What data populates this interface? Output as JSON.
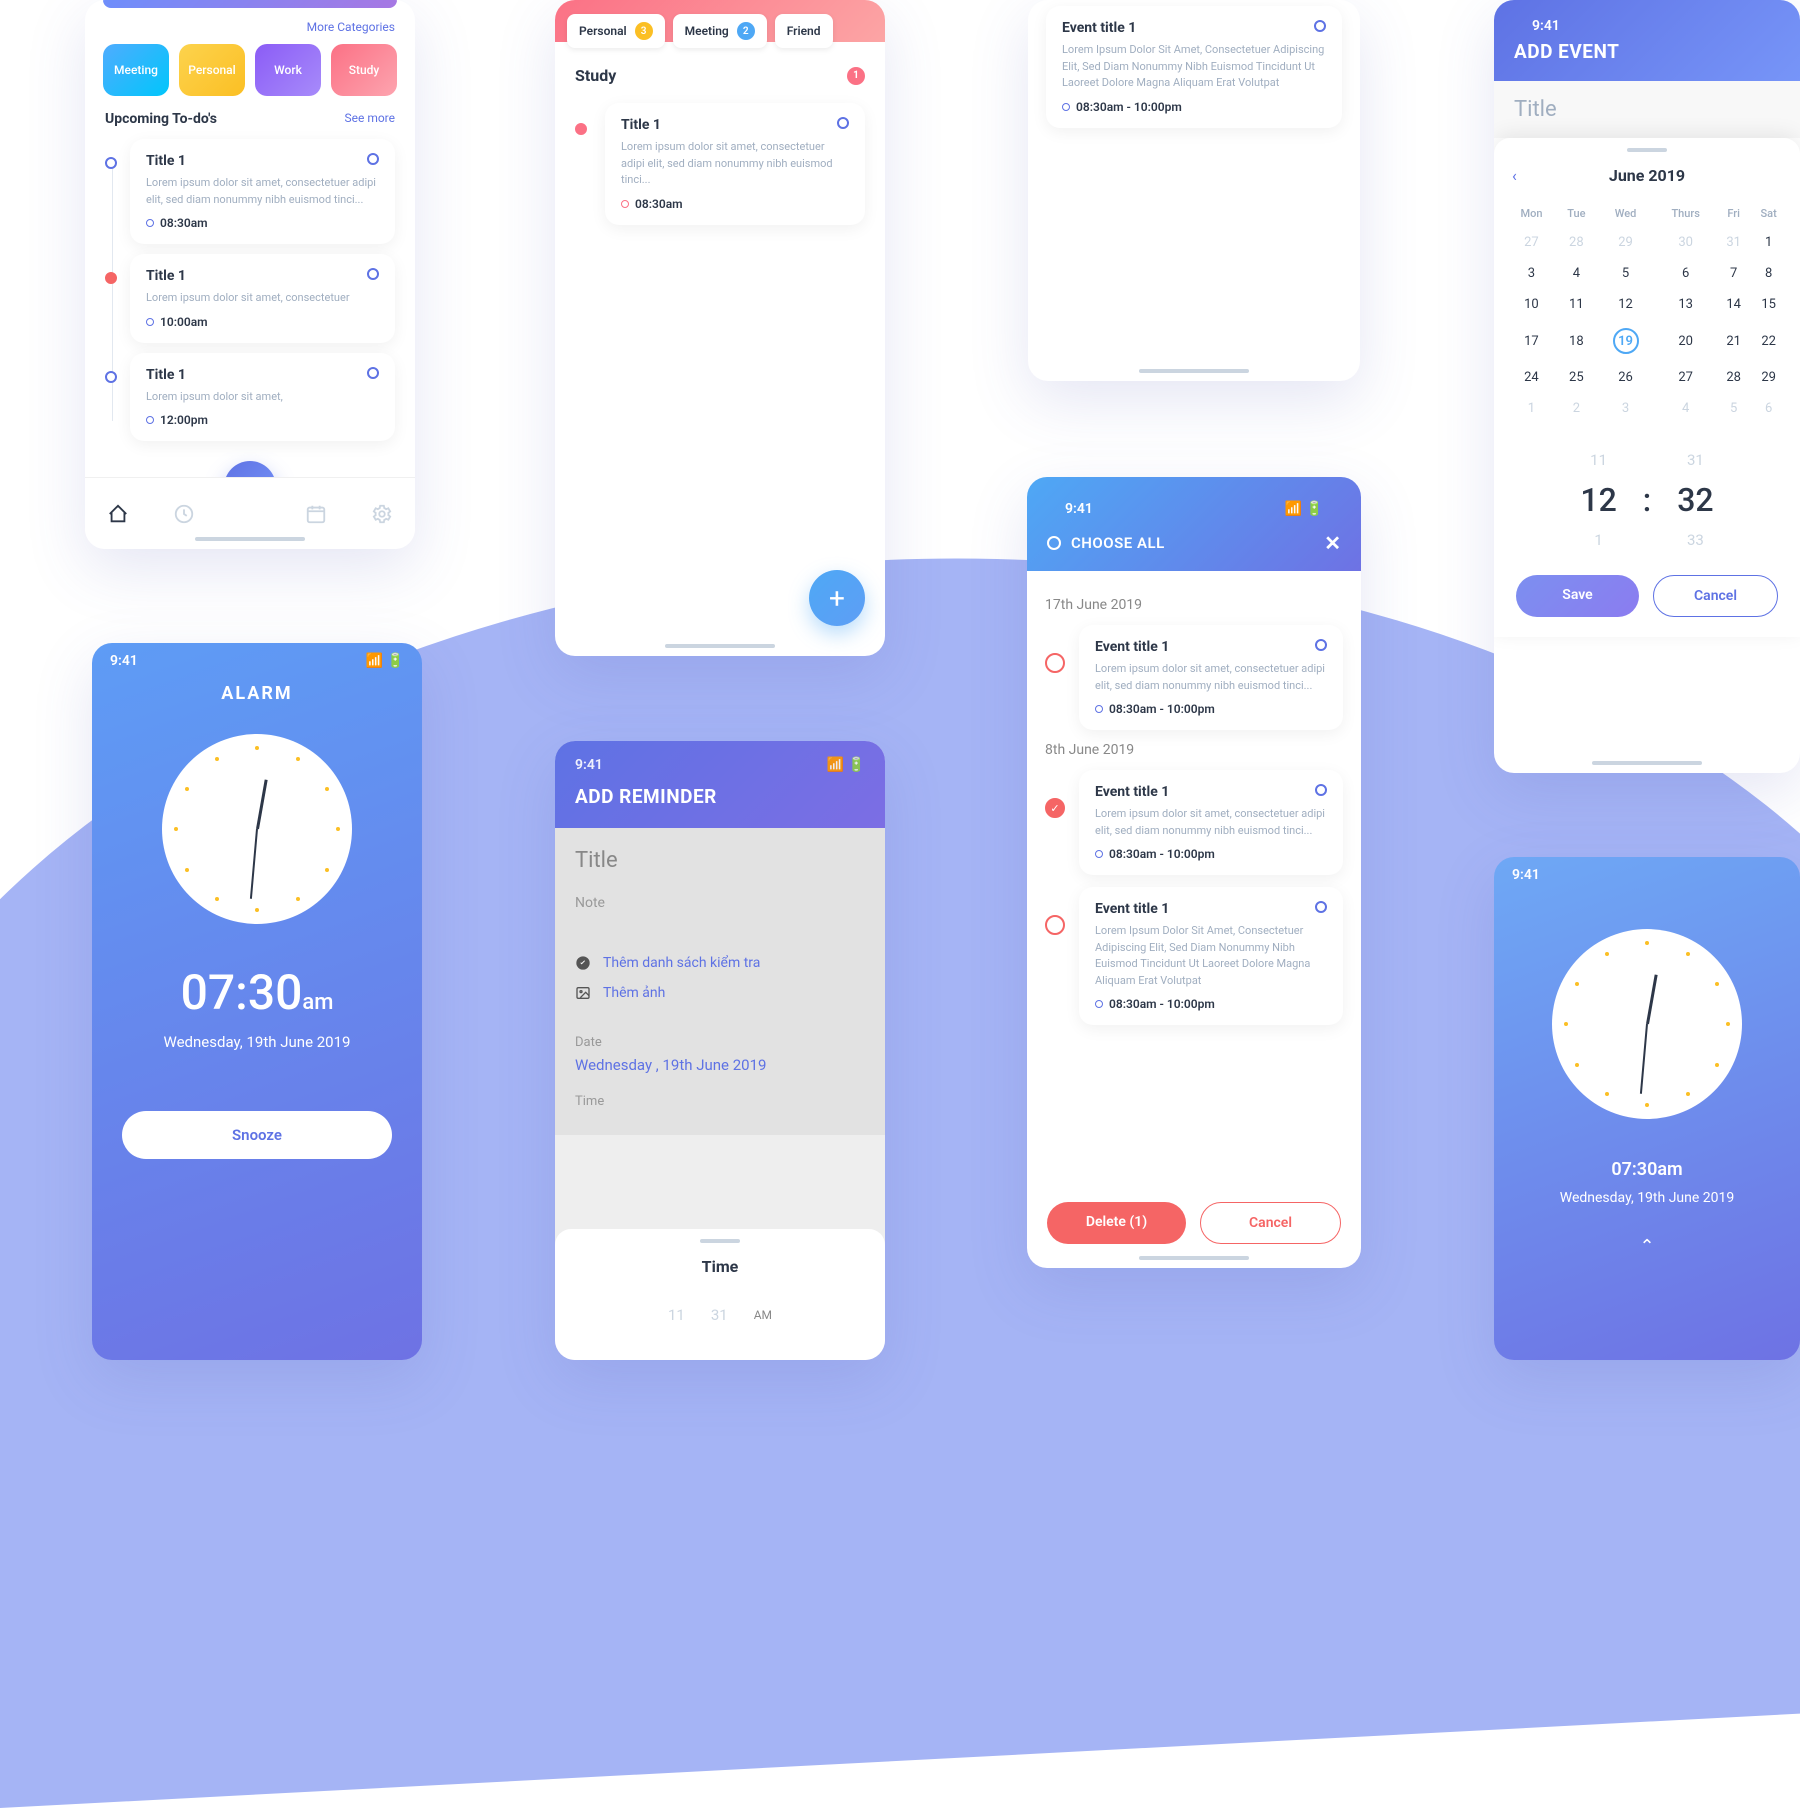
{
  "status_time": "9:41",
  "s1": {
    "more_categories": "More Categories",
    "categories": [
      "Meeting",
      "Personal",
      "Work",
      "Study"
    ],
    "section_title": "Upcoming To-do's",
    "see_more": "See more",
    "todos": [
      {
        "title": "Title 1",
        "desc": "Lorem ipsum dolor sit amet, consectetuer adipi elit, sed diam nonummy nibh euismod tinci...",
        "time": "08:30am",
        "color": "blue"
      },
      {
        "title": "Title 1",
        "desc": "Lorem ipsum dolor sit amet, consectetuer",
        "time": "10:00am",
        "color": "red"
      },
      {
        "title": "Title 1",
        "desc": "Lorem ipsum dolor sit amet,",
        "time": "12:00pm",
        "color": "blue"
      }
    ]
  },
  "s2": {
    "tabs": [
      {
        "label": "Personal",
        "count": "3",
        "badge": "yl"
      },
      {
        "label": "Meeting",
        "count": "2",
        "badge": "bl"
      },
      {
        "label": "Friend",
        "count": "",
        "badge": ""
      }
    ],
    "cat": "Study",
    "cat_count": "1",
    "item": {
      "title": "Title 1",
      "desc": "Lorem ipsum dolor sit amet, consectetuer adipi elit, sed diam nonummy nibh euismod tinci...",
      "time": "08:30am"
    }
  },
  "s3": {
    "title": "Event title 1",
    "desc": "Lorem Ipsum Dolor Sit Amet, Consectetuer Adipiscing Elit, Sed Diam Nonummy Nibh Euismod Tincidunt Ut Laoreet Dolore Magna Aliquam Erat Volutpat",
    "time": "08:30am - 10:00pm"
  },
  "s4": {
    "header": "ADD EVENT",
    "title_placeholder": "Title",
    "month": "June 2019",
    "dows": [
      "Mon",
      "Tue",
      "Wed",
      "Thurs",
      "Fri",
      "Sat"
    ],
    "weeks": [
      [
        "27",
        "28",
        "29",
        "30",
        "31",
        "1"
      ],
      [
        "3",
        "4",
        "5",
        "6",
        "7",
        "8"
      ],
      [
        "10",
        "11",
        "12",
        "13",
        "14",
        "15"
      ],
      [
        "17",
        "18",
        "19",
        "20",
        "21",
        "22"
      ],
      [
        "24",
        "25",
        "26",
        "27",
        "28",
        "29"
      ],
      [
        "1",
        "2",
        "3",
        "4",
        "5",
        "6"
      ]
    ],
    "selected": "19",
    "time_h": [
      "11",
      "12",
      "1"
    ],
    "time_m": [
      "31",
      "32",
      "33"
    ],
    "save": "Save",
    "cancel": "Cancel"
  },
  "s5": {
    "title": "ALARM",
    "time": "07:30",
    "ampm": "am",
    "date": "Wednesday, 19th June 2019",
    "snooze": "Snooze"
  },
  "s6": {
    "header": "ADD REMINDER",
    "title_placeholder": "Title",
    "note_placeholder": "Note",
    "opt1": "Thêm danh sách kiểm tra",
    "opt2": "Thêm ảnh",
    "date_label": "Date",
    "date_value": "Wednesday , 19th June 2019",
    "time_label": "Time",
    "time_header": "Time",
    "time_h": [
      "11"
    ],
    "time_m": [
      "31"
    ],
    "ampm": "AM"
  },
  "s7": {
    "choose_all": "CHOOSE ALL",
    "date1": "17th June 2019",
    "date2": "8th June 2019",
    "events": [
      {
        "title": "Event title 1",
        "desc": "Lorem ipsum dolor sit amet, consectetuer adipi elit, sed diam nonummy nibh euismod tinci...",
        "time": "08:30am - 10:00pm",
        "checked": false
      },
      {
        "title": "Event title 1",
        "desc": "Lorem ipsum dolor sit amet, consectetuer adipi elit, sed diam nonummy nibh euismod tinci...",
        "time": "08:30am - 10:00pm",
        "checked": true
      },
      {
        "title": "Event title 1",
        "desc": "Lorem Ipsum Dolor Sit Amet, Consectetuer Adipiscing Elit, Sed Diam Nonummy Nibh Euismod Tincidunt Ut Laoreet Dolore Magna Aliquam Erat Volutpat",
        "time": "08:30am - 10:00pm",
        "checked": false
      }
    ],
    "delete": "Delete (1)",
    "cancel": "Cancel"
  },
  "s8": {
    "time": "07:30am",
    "date": "Wednesday, 19th June 2019"
  }
}
